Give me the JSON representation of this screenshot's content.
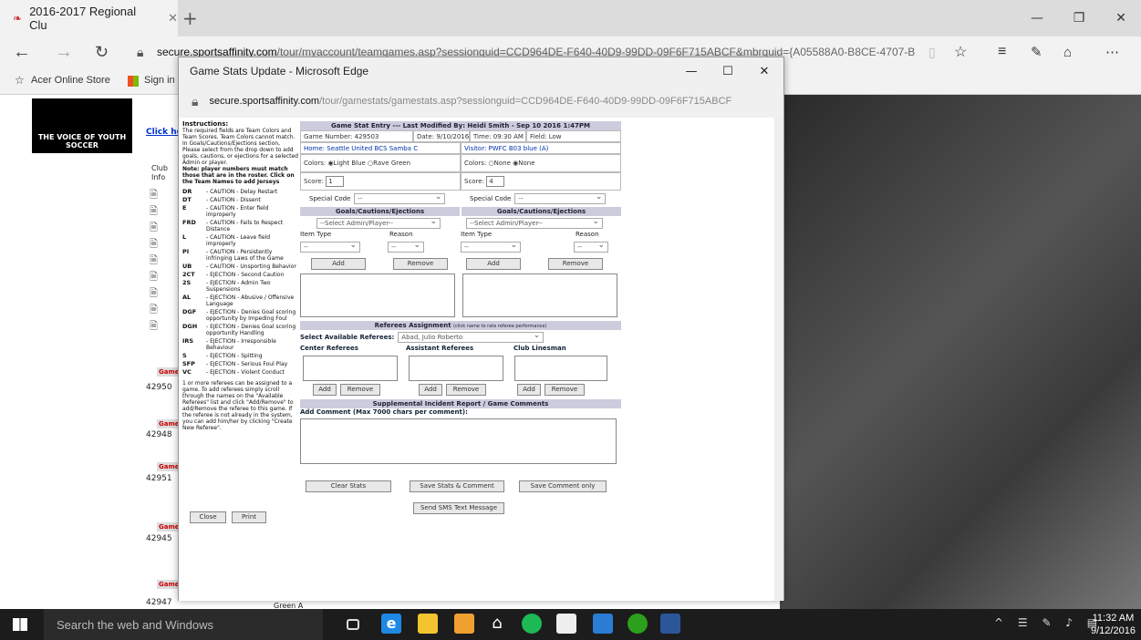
{
  "browser": {
    "tab_title": "2016-2017 Regional Clu",
    "url_domain": "secure.sportsaffinity.com",
    "url_path": "/tour/myaccount/teamgames.asp?sessionguid=CCD964DE-F640-40D9-99DD-09F6F715ABCF&mbrguid={A05588A0-B8CE-4707-B",
    "favorites": [
      "Acer Online Store",
      "Sign in"
    ]
  },
  "background_page": {
    "logo_text": "THE VOICE OF YOUTH SOCCER",
    "click_link": "Click he",
    "col_club": "Club",
    "col_info": "Info",
    "game_label": "Game",
    "game_ids": [
      "42950",
      "42948",
      "42951",
      "42945",
      "42947"
    ],
    "bottom_row_text": "Green A"
  },
  "popup": {
    "title": "Game Stats Update - Microsoft Edge",
    "url_domain": "secure.sportsaffinity.com",
    "url_path": "/tour/gamestats/gamestats.asp?sessionguid=CCD964DE-F640-40D9-99DD-09F6F715ABCF",
    "instructions": {
      "heading": "Instructions:",
      "p1": "The required fields are Team Colors and Team Scores. Team Colors cannot match.",
      "p2": "In Goals/Cautions/Ejections section, Please select from the drop down to add goals, cautions, or ejections for a selected Admin or player.",
      "p3": "Note: player numbers must match those that are in the roster. Click on the Team Names to add Jerseys",
      "codes": [
        {
          "code": "DR",
          "desc": "- CAUTION - Delay Restart"
        },
        {
          "code": "DT",
          "desc": "- CAUTION - Dissent"
        },
        {
          "code": "E",
          "desc": "- CAUTION - Enter field improperly"
        },
        {
          "code": "FRD",
          "desc": "- CAUTION - Fails to Respect Distance"
        },
        {
          "code": "L",
          "desc": "- CAUTION - Leave field improperly"
        },
        {
          "code": "PI",
          "desc": "- CAUTION - Persistently infringing Laws of the Game"
        },
        {
          "code": "UB",
          "desc": "- CAUTION - Unsporting Behavior"
        },
        {
          "code": "2CT",
          "desc": "- EJECTION - Second Caution"
        },
        {
          "code": "2S",
          "desc": "- EJECTION - Admin Two Suspensions"
        },
        {
          "code": "AL",
          "desc": "- EJECTION - Abusive / Offensive Language"
        },
        {
          "code": "DGF",
          "desc": "- EJECTION - Denies Goal scoring opportunity by Impeding Foul"
        },
        {
          "code": "DGH",
          "desc": "- EJECTION - Denies Goal scoring opportunity Handling"
        },
        {
          "code": "IRS",
          "desc": "- EJECTION - Irresponsible Behaviour"
        },
        {
          "code": "S",
          "desc": "- EJECTION - Spitting"
        },
        {
          "code": "SFP",
          "desc": "- EJECTION - Serious Foul Play"
        },
        {
          "code": "VC",
          "desc": "- EJECTION - Violent Conduct"
        }
      ],
      "p4": "1 or more referees can be assigned to a game. To add referees simply scroll through the names on the \"Available Referees\" list and click \"Add/Remove\" to add/Remove the referee to this game. If the referee is not already in the system, you can add him/her by clicking \"Create New Referee\"."
    },
    "close_btn": "Close",
    "print_btn": "Print",
    "form": {
      "header": "Game Stat Entry --- Last Modified By: Heidi Smith - Sep 10 2016 1:47PM",
      "game_number": "Game Number: 429503",
      "date": "Date: 9/10/2016",
      "time": "Time: 09:30 AM",
      "field": "Field: Low",
      "home": "Home: Seattle United BCS Samba C",
      "visitor": "Visitor: PWFC B03 blue (A)",
      "home_colors_label": "Colors:",
      "home_color_opt1": "Light Blue",
      "home_color_opt2": "Rave Green",
      "visitor_colors_label": "Colors:",
      "visitor_color_opt1": "None",
      "visitor_color_opt2": "None",
      "score_label": "Score:",
      "home_score": "1",
      "visitor_score": "4",
      "special_code_label": "Special Code",
      "special_code_value": "--",
      "goals_header": "Goals/Cautions/Ejections",
      "select_admin": "--Select Admin/Player--",
      "item_type_label": "Item Type",
      "reason_label": "Reason",
      "item_type_value": "--",
      "reason_value": "--",
      "add_btn": "Add",
      "remove_btn": "Remove",
      "referees_header": "Referees Assignment",
      "referees_note": "(click name to rate referee performance)",
      "select_referees_label": "Select Available Referees:",
      "select_referees_value": "Abad, Julio Roberto",
      "center_refs": "Center Referees",
      "assistant_refs": "Assistant Referees",
      "club_linesman": "Club Linesman",
      "incident_header": "Supplemental Incident Report / Game Comments",
      "comment_label": "Add Comment (Max 7000 chars per comment):",
      "clear_btn": "Clear Stats",
      "save_stats_btn": "Save Stats & Comment",
      "save_comment_btn": "Save Comment only",
      "sms_btn": "Send SMS Text Message"
    }
  },
  "taskbar": {
    "search_placeholder": "Search the web and Windows",
    "time": "11:32 AM",
    "date": "9/12/2016"
  }
}
